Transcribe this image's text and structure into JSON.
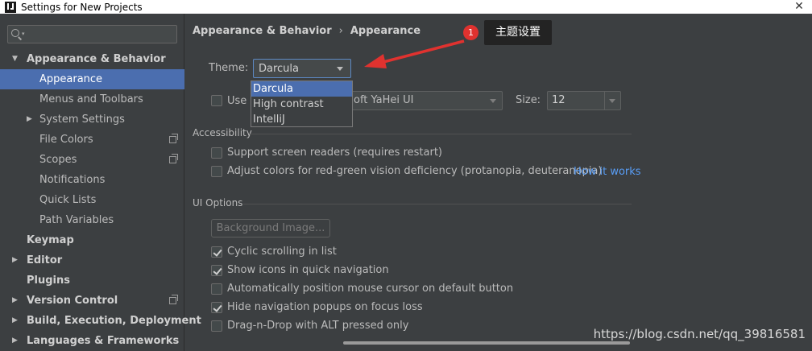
{
  "window": {
    "title": "Settings for New Projects",
    "close_glyph": "✕"
  },
  "sidebar": {
    "search_placeholder": "",
    "items": [
      {
        "label": "Appearance & Behavior",
        "level": 0,
        "bold": true,
        "expanded": true,
        "arrow": "▼"
      },
      {
        "label": "Appearance",
        "level": 1,
        "selected": true
      },
      {
        "label": "Menus and Toolbars",
        "level": 1
      },
      {
        "label": "System Settings",
        "level": 1,
        "arrow": "▶"
      },
      {
        "label": "File Colors",
        "level": 1,
        "page_icon": true
      },
      {
        "label": "Scopes",
        "level": 1,
        "page_icon": true
      },
      {
        "label": "Notifications",
        "level": 1
      },
      {
        "label": "Quick Lists",
        "level": 1
      },
      {
        "label": "Path Variables",
        "level": 1
      },
      {
        "label": "Keymap",
        "level": 0,
        "bold": true
      },
      {
        "label": "Editor",
        "level": 0,
        "bold": true,
        "arrow": "▶"
      },
      {
        "label": "Plugins",
        "level": 0,
        "bold": true
      },
      {
        "label": "Version Control",
        "level": 0,
        "bold": true,
        "arrow": "▶",
        "page_icon": true
      },
      {
        "label": "Build, Execution, Deployment",
        "level": 0,
        "bold": true,
        "arrow": "▶"
      },
      {
        "label": "Languages & Frameworks",
        "level": 0,
        "bold": true,
        "arrow": "▶"
      }
    ]
  },
  "breadcrumb": {
    "parent": "Appearance & Behavior",
    "separator": "›",
    "current": "Appearance"
  },
  "theme": {
    "label": "Theme:",
    "value": "Darcula",
    "options": [
      "Darcula",
      "High contrast",
      "IntelliJ"
    ],
    "selected_index": 0
  },
  "font": {
    "checkbox_label": "Use c",
    "value": "oft YaHei UI",
    "size_label": "Size:",
    "size_value": "12"
  },
  "accessibility": {
    "title": "Accessibility",
    "options": [
      {
        "label": "Support screen readers (requires restart)",
        "checked": false
      },
      {
        "label": "Adjust colors for red-green vision deficiency (protanopia, deuteranopia)",
        "checked": false
      }
    ],
    "link": "How it works"
  },
  "ui_options": {
    "title": "UI Options",
    "background_button": "Background Image...",
    "options": [
      {
        "label": "Cyclic scrolling in list",
        "checked": true
      },
      {
        "label": "Show icons in quick navigation",
        "checked": true
      },
      {
        "label": "Automatically position mouse cursor on default button",
        "checked": false
      },
      {
        "label": "Hide navigation popups on focus loss",
        "checked": true
      },
      {
        "label": "Drag-n-Drop with ALT pressed only",
        "checked": false
      }
    ]
  },
  "annotation": {
    "badge": "1",
    "tooltip": "主题设置",
    "color": "#e0322f"
  },
  "watermark": "https://blog.csdn.net/qq_39816581"
}
